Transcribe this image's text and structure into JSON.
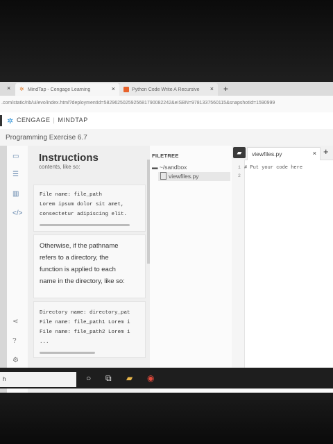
{
  "browser": {
    "tabs": [
      {
        "label": "MindTap - Cengage Learning",
        "close": "×"
      },
      {
        "label": "Python Code Write A Recursive",
        "close": "×"
      }
    ],
    "new_tab": "+",
    "leading_close": "×",
    "url": ".com/static/nb/ui/evo/index.html?deploymentId=5829625025925681790082242&eISBN=9781337560115&snapshotId=1590999"
  },
  "app": {
    "brand_left": "CENGAGE",
    "brand_right": "MINDTAP",
    "exercise_title": "Programming Exercise 6.7"
  },
  "instructions": {
    "title": "Instructions",
    "cutoff_text": "contents, like so:",
    "code_block_1": [
      "File name: file_path",
      "Lorem ipsum dolor sit amet,",
      "consectetur adipiscing elit."
    ],
    "paragraph": [
      "Otherwise, if the pathname",
      "refers to a directory, the",
      "function is applied to each",
      "name in the directory, like so:"
    ],
    "code_block_2": [
      "Directory name: directory_pat",
      "File name: file_path1 Lorem i",
      "File name: file_path2 Lorem i",
      "..."
    ]
  },
  "filetree": {
    "title": "FILETREE",
    "folder": "~/sandbox",
    "file": "viewfiles.py"
  },
  "editor": {
    "tab_name": "viewfiles.py",
    "tab_close": "×",
    "add_tab": "+",
    "line_numbers": [
      "1",
      "2"
    ],
    "code": "# Put your code here"
  },
  "taskbar": {
    "search_text": "h"
  },
  "colors": {
    "brand_blue": "#2a8fd6",
    "delete_red": "#d33c3c",
    "screen_bg": "#f3f3f3"
  }
}
